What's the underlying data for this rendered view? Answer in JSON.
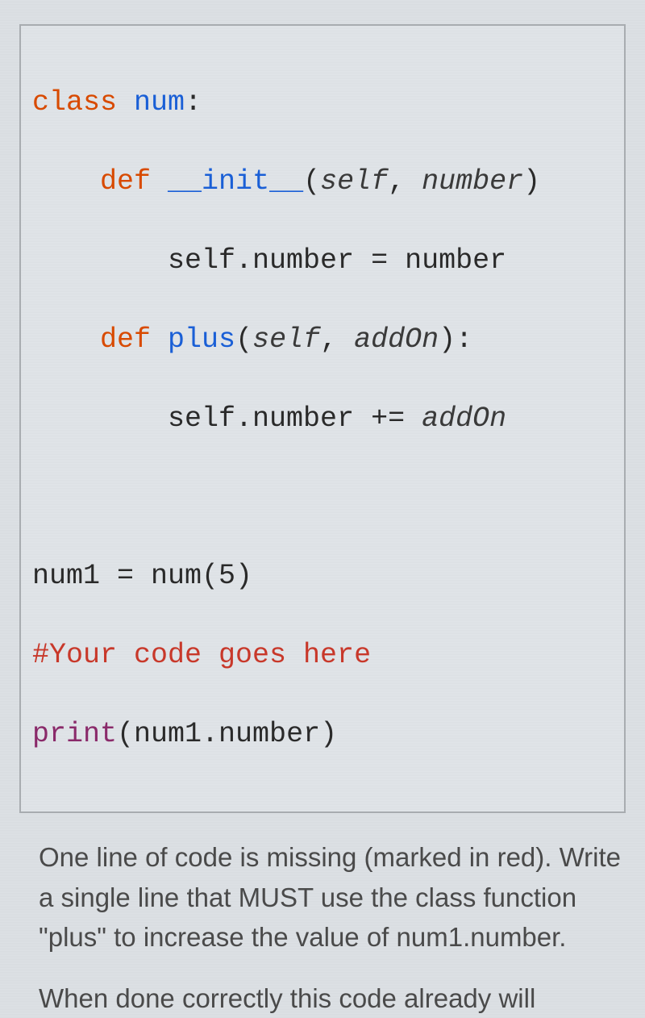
{
  "code": {
    "line1": {
      "kw": "class",
      "name": "num",
      "colon": ":"
    },
    "line2": {
      "indent": "    ",
      "kw": "def",
      "name": "__init__",
      "params_open": "(",
      "p1": "self",
      "comma1": ", ",
      "p2": "number",
      "params_close": ")"
    },
    "line3": {
      "indent": "        ",
      "body": "self.number = number"
    },
    "line4": {
      "indent": "    ",
      "kw": "def",
      "name": "plus",
      "params_open": "(",
      "p1": "self",
      "comma1": ", ",
      "p2": "addOn",
      "params_close": "):"
    },
    "line5": {
      "indent": "        ",
      "body_a": "self.number += ",
      "body_b": "addOn"
    },
    "line7": {
      "body": "num1 = num(5)"
    },
    "line8": {
      "comment": "#Your code goes here"
    },
    "line9": {
      "builtin": "print",
      "rest": "(num1.number)"
    }
  },
  "instructions": {
    "p1": "One line of code is missing (marked in red). Write a single line that MUST use the class function \"plus\" to increase the value of num1.number.",
    "p2": "When done correctly this code already will"
  }
}
